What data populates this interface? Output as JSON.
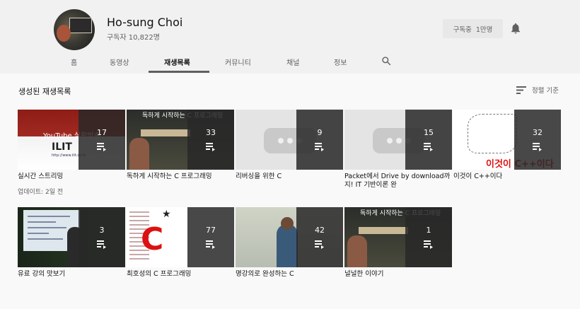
{
  "channel": {
    "name": "Ho-sung Choi",
    "subscribers": "구독자 10,822명",
    "subscribe_button": {
      "label": "구독중",
      "count": "1만명"
    }
  },
  "tabs": [
    {
      "label": "홈",
      "active": false
    },
    {
      "label": "동영상",
      "active": false
    },
    {
      "label": "재생목록",
      "active": true
    },
    {
      "label": "커뮤니티",
      "active": false
    },
    {
      "label": "채널",
      "active": false
    },
    {
      "label": "정보",
      "active": false
    }
  ],
  "section": {
    "title": "생성된 재생목록",
    "sort_label": "정렬 기준"
  },
  "playlists": [
    {
      "title": "실시간 스트리밍",
      "count": "17",
      "meta": "업데이트: 2일 전",
      "thumb_text": {
        "banner": "YouTube 실황방송",
        "logo": "ILIT",
        "url": "http://www.ilit.co.kr"
      }
    },
    {
      "title": "독하게 시작하는 C 프로그래밍",
      "count": "33",
      "thumb_text": {
        "cover": "독하게 시작하는 C 프로그래밍"
      }
    },
    {
      "title": "리버싱을 위한 C",
      "count": "9"
    },
    {
      "title": "Packet에서 Drive by download까지! IT 기반이론 완",
      "count": "15"
    },
    {
      "title": "이것이 C++이다",
      "count": "32",
      "thumb_text": {
        "cover": "이것이 C++이다"
      }
    },
    {
      "title": "유료 강의 맛보기",
      "count": "3"
    },
    {
      "title": "최호성의 C 프로그래밍",
      "count": "77",
      "thumb_text": {
        "cover": "C"
      }
    },
    {
      "title": "명강의로 완성하는 C",
      "count": "42"
    },
    {
      "title": "널널한 이야기",
      "count": "1",
      "thumb_text": {
        "cover": "독하게 시작하는 C 프로그래밍"
      }
    }
  ],
  "icons": {
    "bell": "bell-icon",
    "search": "search-icon",
    "sort": "sort-icon",
    "playlist": "playlist-icon"
  },
  "colors": {
    "header_bg": "#f1f1f1",
    "page_bg": "#f9f9f9",
    "overlay": "#282828",
    "accent_red": "#d11"
  }
}
